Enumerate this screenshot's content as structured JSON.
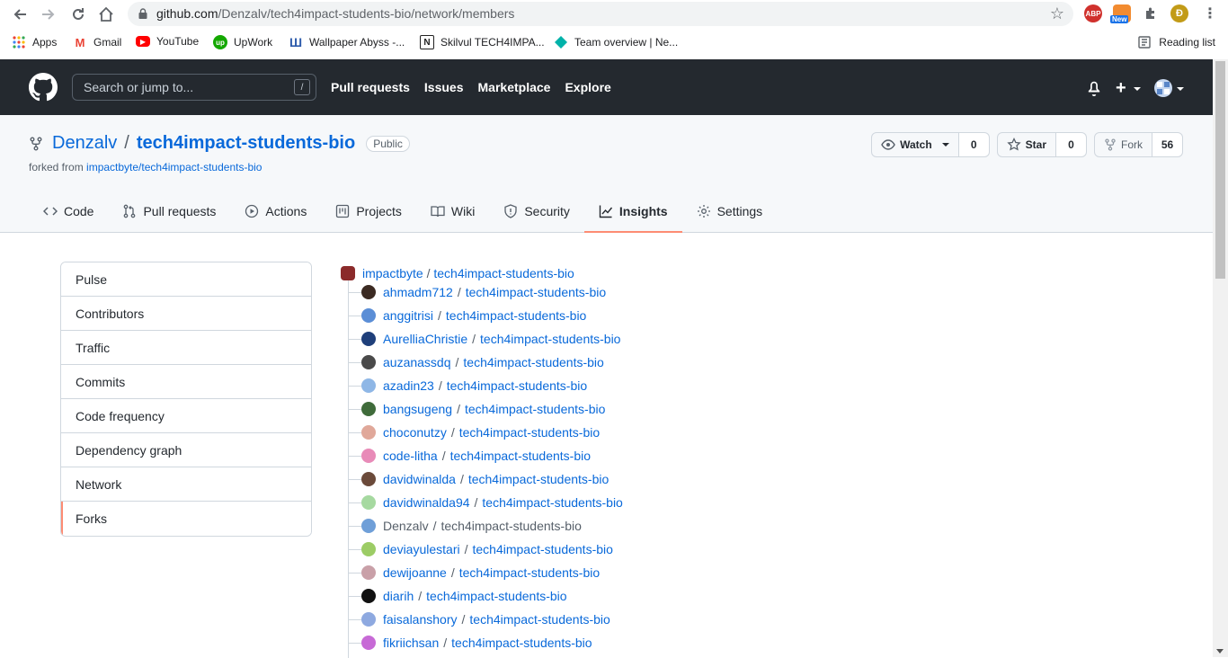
{
  "browser": {
    "url_host": "github.com",
    "url_path": "/Denzalv/tech4impact-students-bio/network/members",
    "new_badge": "New",
    "abp_label": "ABP",
    "bookmarks": [
      {
        "label": "Apps",
        "icon": "apps-grid-icon"
      },
      {
        "label": "Gmail",
        "icon": "gmail-icon"
      },
      {
        "label": "YouTube",
        "icon": "youtube-icon"
      },
      {
        "label": "UpWork",
        "icon": "upwork-icon"
      },
      {
        "label": "Wallpaper Abyss -...",
        "icon": "wallpaper-abyss-icon"
      },
      {
        "label": "Skilvul TECH4IMPA...",
        "icon": "notion-icon"
      },
      {
        "label": "Team overview | Ne...",
        "icon": "diamond-icon"
      }
    ],
    "reading_list": "Reading list"
  },
  "github": {
    "search_placeholder": "Search or jump to...",
    "search_shortcut": "/",
    "nav": [
      "Pull requests",
      "Issues",
      "Marketplace",
      "Explore"
    ]
  },
  "repo": {
    "owner": "Denzalv",
    "separator": "/",
    "name": "tech4impact-students-bio",
    "visibility": "Public",
    "forked_prefix": "forked from",
    "forked_from": "impactbyte/tech4impact-students-bio",
    "watch_label": "Watch",
    "watch_count": "0",
    "star_label": "Star",
    "star_count": "0",
    "fork_label": "Fork",
    "fork_count": "56",
    "tabs": [
      {
        "label": "Code",
        "icon": "code-icon"
      },
      {
        "label": "Pull requests",
        "icon": "pull-request-icon"
      },
      {
        "label": "Actions",
        "icon": "play-icon"
      },
      {
        "label": "Projects",
        "icon": "project-icon"
      },
      {
        "label": "Wiki",
        "icon": "book-icon"
      },
      {
        "label": "Security",
        "icon": "shield-icon"
      },
      {
        "label": "Insights",
        "icon": "graph-icon"
      },
      {
        "label": "Settings",
        "icon": "gear-icon"
      }
    ],
    "active_tab": "Insights"
  },
  "sidebar": {
    "items": [
      "Pulse",
      "Contributors",
      "Traffic",
      "Commits",
      "Code frequency",
      "Dependency graph",
      "Network",
      "Forks"
    ],
    "active": "Forks"
  },
  "network": {
    "root_owner": "impactbyte",
    "root_repo": "tech4impact-students-bio",
    "separator": "/",
    "forks": [
      {
        "owner": "ahmadm712",
        "repo": "tech4impact-students-bio",
        "avatar_color": "#3b2a22"
      },
      {
        "owner": "anggitrisi",
        "repo": "tech4impact-students-bio",
        "avatar_color": "#5b8ed6"
      },
      {
        "owner": "AurelliaChristie",
        "repo": "tech4impact-students-bio",
        "avatar_color": "#1f3f7a"
      },
      {
        "owner": "auzanassdq",
        "repo": "tech4impact-students-bio",
        "avatar_color": "#4a4a4a"
      },
      {
        "owner": "azadin23",
        "repo": "tech4impact-students-bio",
        "avatar_color": "#8fb7e6"
      },
      {
        "owner": "bangsugeng",
        "repo": "tech4impact-students-bio",
        "avatar_color": "#3f6b3a"
      },
      {
        "owner": "choconutzy",
        "repo": "tech4impact-students-bio",
        "avatar_color": "#e0a89a"
      },
      {
        "owner": "code-litha",
        "repo": "tech4impact-students-bio",
        "avatar_color": "#e88bb8"
      },
      {
        "owner": "davidwinalda",
        "repo": "tech4impact-students-bio",
        "avatar_color": "#6b4a3a"
      },
      {
        "owner": "davidwinalda94",
        "repo": "tech4impact-students-bio",
        "avatar_color": "#a6d9a0"
      },
      {
        "owner": "Denzalv",
        "repo": "tech4impact-students-bio",
        "avatar_color": "#6f9fd8",
        "current": true
      },
      {
        "owner": "deviayulestari",
        "repo": "tech4impact-students-bio",
        "avatar_color": "#9ccc65"
      },
      {
        "owner": "dewijoanne",
        "repo": "tech4impact-students-bio",
        "avatar_color": "#c9a0a8"
      },
      {
        "owner": "diarih",
        "repo": "tech4impact-students-bio",
        "avatar_color": "#111111"
      },
      {
        "owner": "faisalanshory",
        "repo": "tech4impact-students-bio",
        "avatar_color": "#8ea9e0"
      },
      {
        "owner": "fikriichsan",
        "repo": "tech4impact-students-bio",
        "avatar_color": "#c76ad6"
      }
    ]
  }
}
